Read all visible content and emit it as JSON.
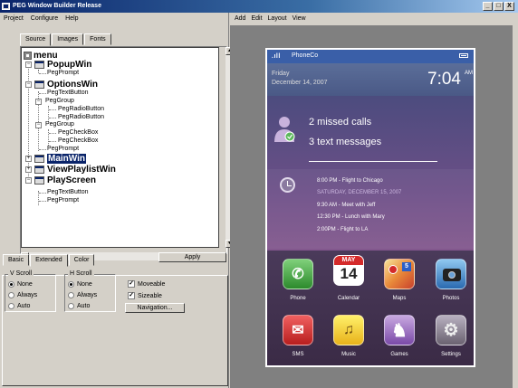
{
  "window": {
    "title": "PEG Window Builder Release",
    "min": "_",
    "max": "□",
    "close": "X"
  },
  "left_menu": [
    "Project",
    "Configure",
    "Help"
  ],
  "top_tabs": [
    "Source",
    "Images",
    "Fonts"
  ],
  "tree": {
    "items": [
      {
        "label": "menu"
      },
      {
        "label": "PopupWin"
      },
      {
        "label": "PegPrompt"
      },
      {
        "label": "OptionsWin"
      },
      {
        "label": "PegTextButton"
      },
      {
        "label": "PegGroup"
      },
      {
        "label": "PegRadioButton"
      },
      {
        "label": "PegRadioButton"
      },
      {
        "label": "PegGroup"
      },
      {
        "label": "PegCheckBox"
      },
      {
        "label": "PegCheckBox"
      },
      {
        "label": "PegPrompt"
      },
      {
        "label": "MainWin"
      },
      {
        "label": "ViewPlaylistWin"
      },
      {
        "label": "PlayScreen"
      },
      {
        "label": "PegTextButton"
      },
      {
        "label": "PegPrompt"
      }
    ],
    "expander_plus": "+",
    "expander_minus": "−"
  },
  "bottom_tabs": [
    "Basic",
    "Extended",
    "Color"
  ],
  "apply_label": "Apply",
  "props": {
    "vscroll_title": "V Scroll",
    "hscroll_title": "H Scroll",
    "vscroll_options": [
      "None",
      "Always",
      "Auto"
    ],
    "hscroll_options": [
      "None",
      "Always",
      "Auto"
    ],
    "moveable_label": "Moveable",
    "sizeable_label": "Sizeable",
    "check_mark": "✓",
    "navigation_label": "Navigation..."
  },
  "right_menu": [
    "Add",
    "Edit",
    "Layout",
    "View"
  ],
  "phone": {
    "carrier": "PhoneCo",
    "signal": ".ıll",
    "day": "Friday",
    "date": "December 14, 2007",
    "time": "7:04",
    "ampm": "AM",
    "missed_calls": "2 missed calls",
    "text_messages": "3 text messages",
    "schedule": [
      "8:00 PM - Flight to Chicago",
      "SATURDAY, DECEMBER 15, 2007",
      "9:30 AM - Meet with Jeff",
      "12:30 PM - Lunch with Mary",
      "2:00PM - Flight to LA"
    ],
    "calendar_month": "MAY",
    "calendar_day": "14",
    "maps_badge": "5",
    "apps": [
      "Phone",
      "Calendar",
      "Maps",
      "Photos",
      "SMS",
      "Music",
      "Games",
      "Settings"
    ],
    "glyphs": {
      "phone": "✆",
      "sms": "✉",
      "music": "♫",
      "games": "♞",
      "settings": "⚙"
    }
  }
}
